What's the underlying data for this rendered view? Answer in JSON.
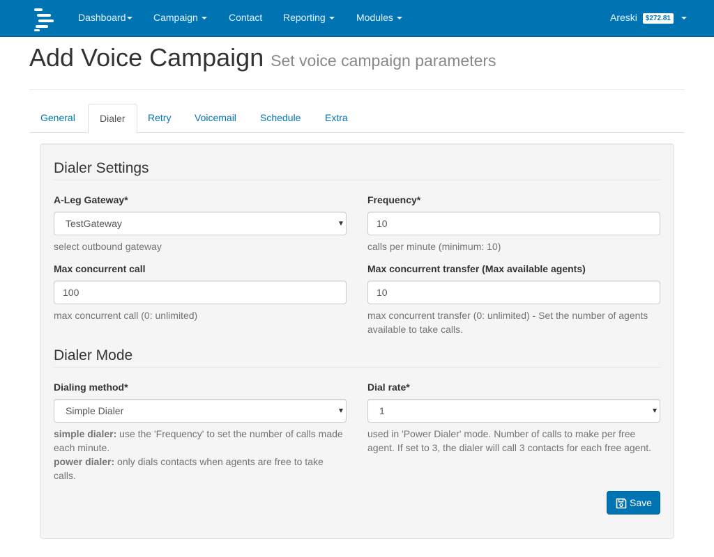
{
  "nav": {
    "items": [
      {
        "label": "Dashboard",
        "dropdown": true
      },
      {
        "label": "Campaign",
        "dropdown": true
      },
      {
        "label": "Contact",
        "dropdown": false
      },
      {
        "label": "Reporting",
        "dropdown": true
      },
      {
        "label": "Modules",
        "dropdown": true
      }
    ],
    "user": {
      "name": "Areski",
      "balance": "$272.81"
    },
    "brand_color": "#0074b3"
  },
  "header": {
    "title": "Add Voice Campaign",
    "subtitle": "Set voice campaign parameters"
  },
  "tabs": [
    {
      "label": "General",
      "active": false
    },
    {
      "label": "Dialer",
      "active": true
    },
    {
      "label": "Retry",
      "active": false
    },
    {
      "label": "Voicemail",
      "active": false
    },
    {
      "label": "Schedule",
      "active": false
    },
    {
      "label": "Extra",
      "active": false
    }
  ],
  "dialer_settings": {
    "legend": "Dialer Settings",
    "gateway": {
      "label": "A-Leg Gateway*",
      "value": "TestGateway",
      "help": "select outbound gateway"
    },
    "frequency": {
      "label": "Frequency*",
      "value": "10",
      "help": "calls per minute (minimum: 10)"
    },
    "max_call": {
      "label": "Max concurrent call",
      "value": "100",
      "help": "max concurrent call (0: unlimited)"
    },
    "max_transfer": {
      "label": "Max concurrent transfer (Max available agents)",
      "value": "10",
      "help": "max concurrent transfer (0: unlimited) - Set the number of agents available to take calls."
    }
  },
  "dialer_mode": {
    "legend": "Dialer Mode",
    "method": {
      "label": "Dialing method*",
      "value": "Simple Dialer",
      "help_simple_term": "simple dialer:",
      "help_simple_text": " use the 'Frequency' to set the number of calls made each minute.",
      "help_power_term": "power dialer:",
      "help_power_text": " only dials contacts when agents are free to take calls."
    },
    "rate": {
      "label": "Dial rate*",
      "value": "1",
      "help": "used in 'Power Dialer' mode. Number of calls to make per free agent. If set to 3, the dialer will call 3 contacts for each free agent."
    }
  },
  "actions": {
    "save_label": "Save"
  }
}
